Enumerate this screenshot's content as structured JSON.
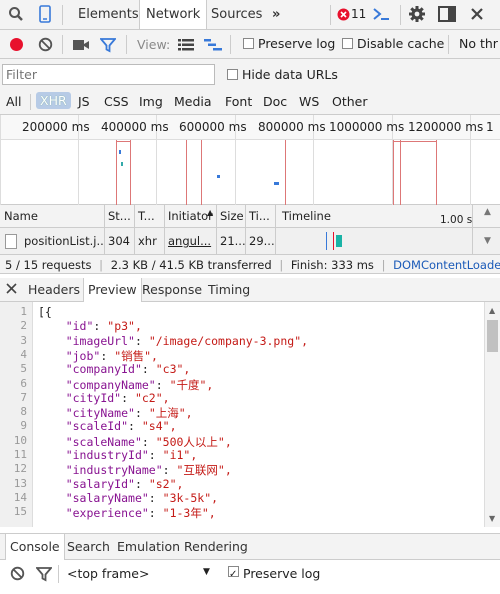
{
  "topbar": {
    "tabs": [
      {
        "label": "Elements"
      },
      {
        "label": "Network"
      },
      {
        "label": "Sources"
      }
    ],
    "more_label": "»",
    "error_count": "11"
  },
  "controls": {
    "view_label": "View:",
    "preserve_log_label": "Preserve log",
    "disable_cache_label": "Disable cache",
    "no_throttle_label": "No thr"
  },
  "filter": {
    "placeholder": "Filter",
    "hide_data_urls_label": "Hide data URLs"
  },
  "types": [
    "All",
    "XHR",
    "JS",
    "CSS",
    "Img",
    "Media",
    "Font",
    "Doc",
    "WS",
    "Other"
  ],
  "timeline": {
    "ticks": [
      "200000 ms",
      "400000 ms",
      "600000 ms",
      "800000 ms",
      "1000000 ms",
      "1200000 ms",
      "1"
    ]
  },
  "table": {
    "headers": {
      "name": "Name",
      "status": "St...",
      "type": "T...",
      "initiator": "Initiator",
      "size": "Size",
      "time": "Ti...",
      "timeline": "Timeline",
      "timeline_scale": "1.00 s"
    },
    "row": {
      "name": "positionList.j...",
      "status": "304",
      "type": "xhr",
      "initiator": "angul...",
      "size": "21...",
      "time": "29..."
    }
  },
  "status_bar": {
    "requests": "5 / 15 requests",
    "transferred": "2.3 KB / 41.5 KB transferred",
    "finish": "Finish: 333 ms",
    "dcl": "DOMContentLoade..."
  },
  "detail_tabs": [
    {
      "label": "Headers"
    },
    {
      "label": "Preview"
    },
    {
      "label": "Response"
    },
    {
      "label": "Timing"
    }
  ],
  "code_lines": [
    {
      "n": "1",
      "text": "[{"
    },
    {
      "n": "2",
      "key": "\"id\"",
      "val": "\"p3\","
    },
    {
      "n": "3",
      "key": "\"imageUrl\"",
      "val": "\"/image/company-3.png\","
    },
    {
      "n": "4",
      "key": "\"job\"",
      "val": "\"销售\","
    },
    {
      "n": "5",
      "key": "\"companyId\"",
      "val": "\"c3\","
    },
    {
      "n": "6",
      "key": "\"companyName\"",
      "val": "\"千度\","
    },
    {
      "n": "7",
      "key": "\"cityId\"",
      "val": "\"c2\","
    },
    {
      "n": "8",
      "key": "\"cityName\"",
      "val": "\"上海\","
    },
    {
      "n": "9",
      "key": "\"scaleId\"",
      "val": "\"s4\","
    },
    {
      "n": "10",
      "key": "\"scaleName\"",
      "val": "\"500人以上\","
    },
    {
      "n": "11",
      "key": "\"industryId\"",
      "val": "\"i1\","
    },
    {
      "n": "12",
      "key": "\"industryName\"",
      "val": "\"互联网\","
    },
    {
      "n": "13",
      "key": "\"salaryId\"",
      "val": "\"s2\","
    },
    {
      "n": "14",
      "key": "\"salaryName\"",
      "val": "\"3k-5k\","
    },
    {
      "n": "15",
      "key": "\"experience\"",
      "val": "\"1-3年\","
    }
  ],
  "console_tabs": [
    {
      "label": "Console"
    },
    {
      "label": "Search"
    },
    {
      "label": "Emulation"
    },
    {
      "label": "Rendering"
    }
  ],
  "console": {
    "frame_label": "<top frame>",
    "preserve_log_label": "Preserve log"
  },
  "colors": {
    "accent": "#3879d9",
    "error": "#e8112d",
    "selected_bg": "#b7cbe6"
  }
}
